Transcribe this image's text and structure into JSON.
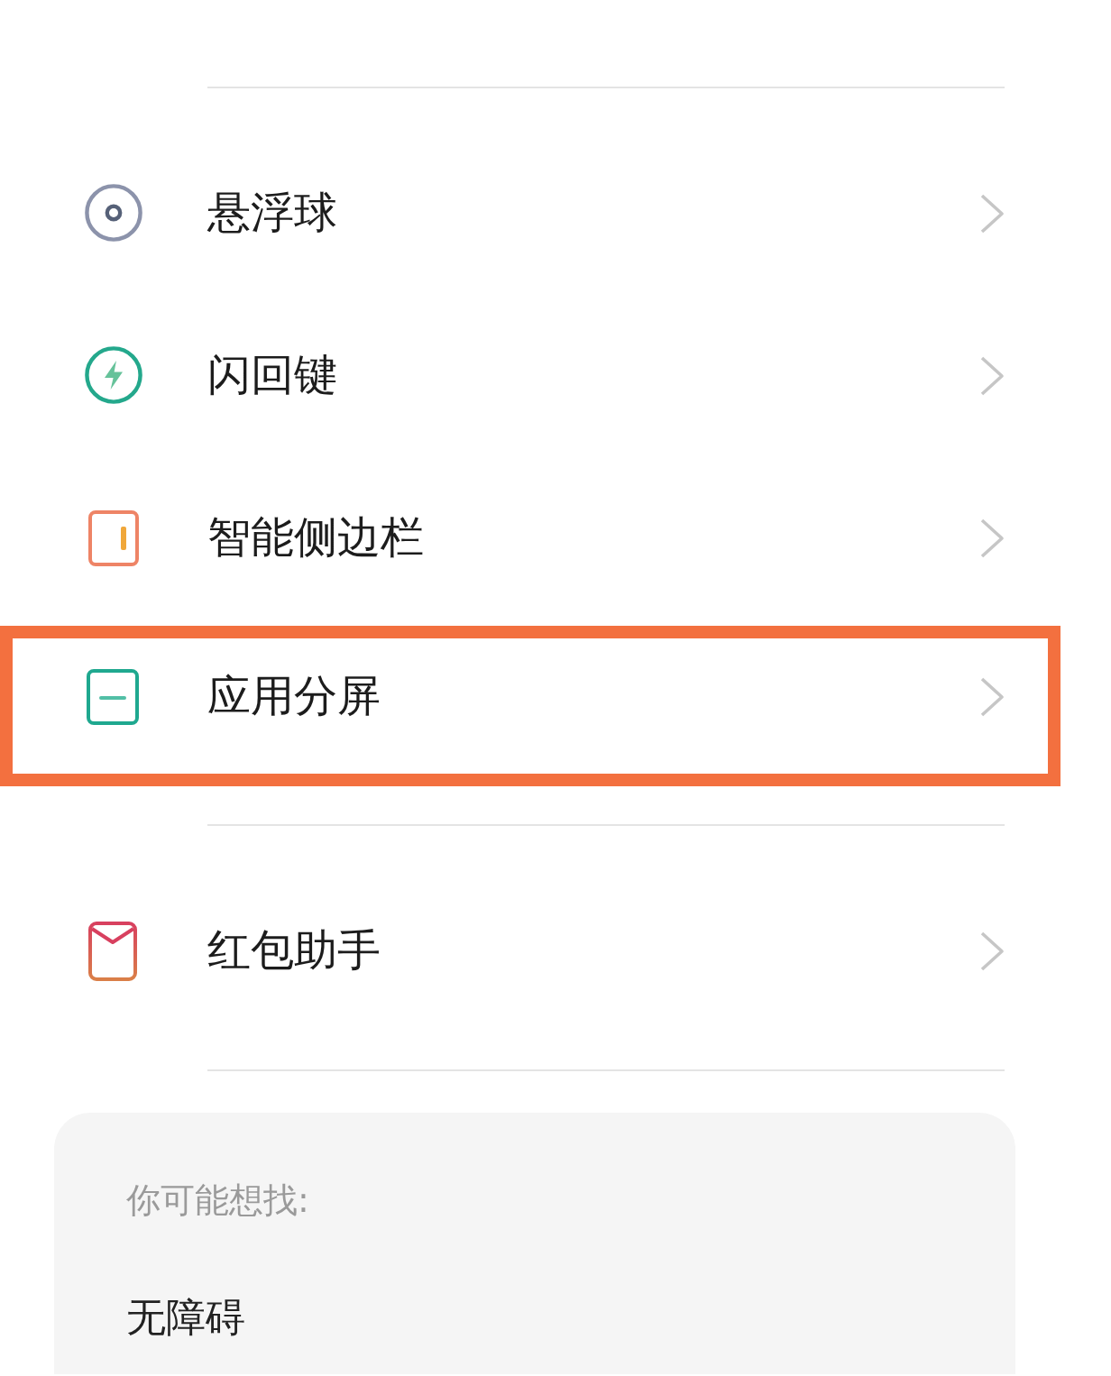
{
  "groups": [
    {
      "items": [
        {
          "label": "悬浮球",
          "highlighted": false
        },
        {
          "label": "闪回键",
          "highlighted": false
        },
        {
          "label": "智能侧边栏",
          "highlighted": false
        },
        {
          "label": "应用分屏",
          "highlighted": true
        }
      ]
    },
    {
      "items": [
        {
          "label": "红包助手",
          "highlighted": false
        }
      ]
    }
  ],
  "suggestions": {
    "title": "你可能想找:",
    "items": [
      {
        "label": "无障碍"
      }
    ]
  }
}
